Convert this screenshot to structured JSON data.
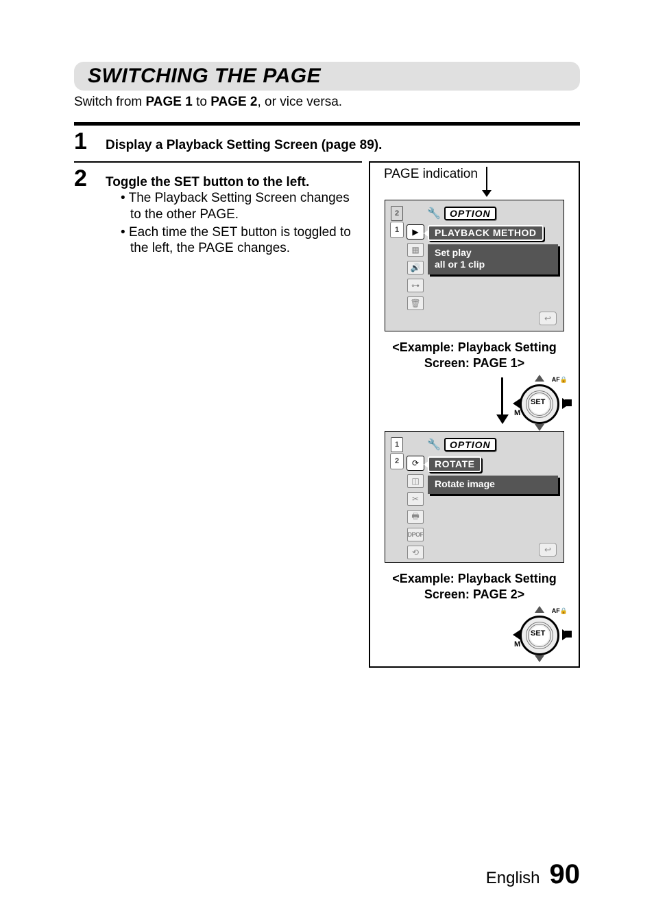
{
  "title": "SWITCHING THE PAGE",
  "intro_pre": "Switch from ",
  "intro_b1": "PAGE 1",
  "intro_mid": " to ",
  "intro_b2": "PAGE 2",
  "intro_post": ", or vice versa.",
  "step1_num": "1",
  "step1_head": "Display a Playback Setting Screen (page 89).",
  "step2_num": "2",
  "step2_head": "Toggle the SET button to the left.",
  "bullet1": "The Playback Setting Screen changes to the other PAGE.",
  "bullet2": "Each time the SET button is toggled to the left, the PAGE changes.",
  "page_indication": "PAGE indication",
  "option_label": "OPTION",
  "screen1_sel_title": "PLAYBACK METHOD",
  "screen1_desc_l1": "Set play",
  "screen1_desc_l2": "all or 1 clip",
  "caption1": "<Example: Playback Setting Screen: PAGE 1>",
  "screen2_sel_title": "ROTATE",
  "screen2_desc": "Rotate image",
  "caption2": "<Example: Playback Setting Screen: PAGE 2>",
  "dial_set": "SET",
  "dial_af": "AF🔒",
  "dial_m": "M",
  "dpof": "DPOF",
  "footer_lang": "English",
  "footer_page": "90"
}
